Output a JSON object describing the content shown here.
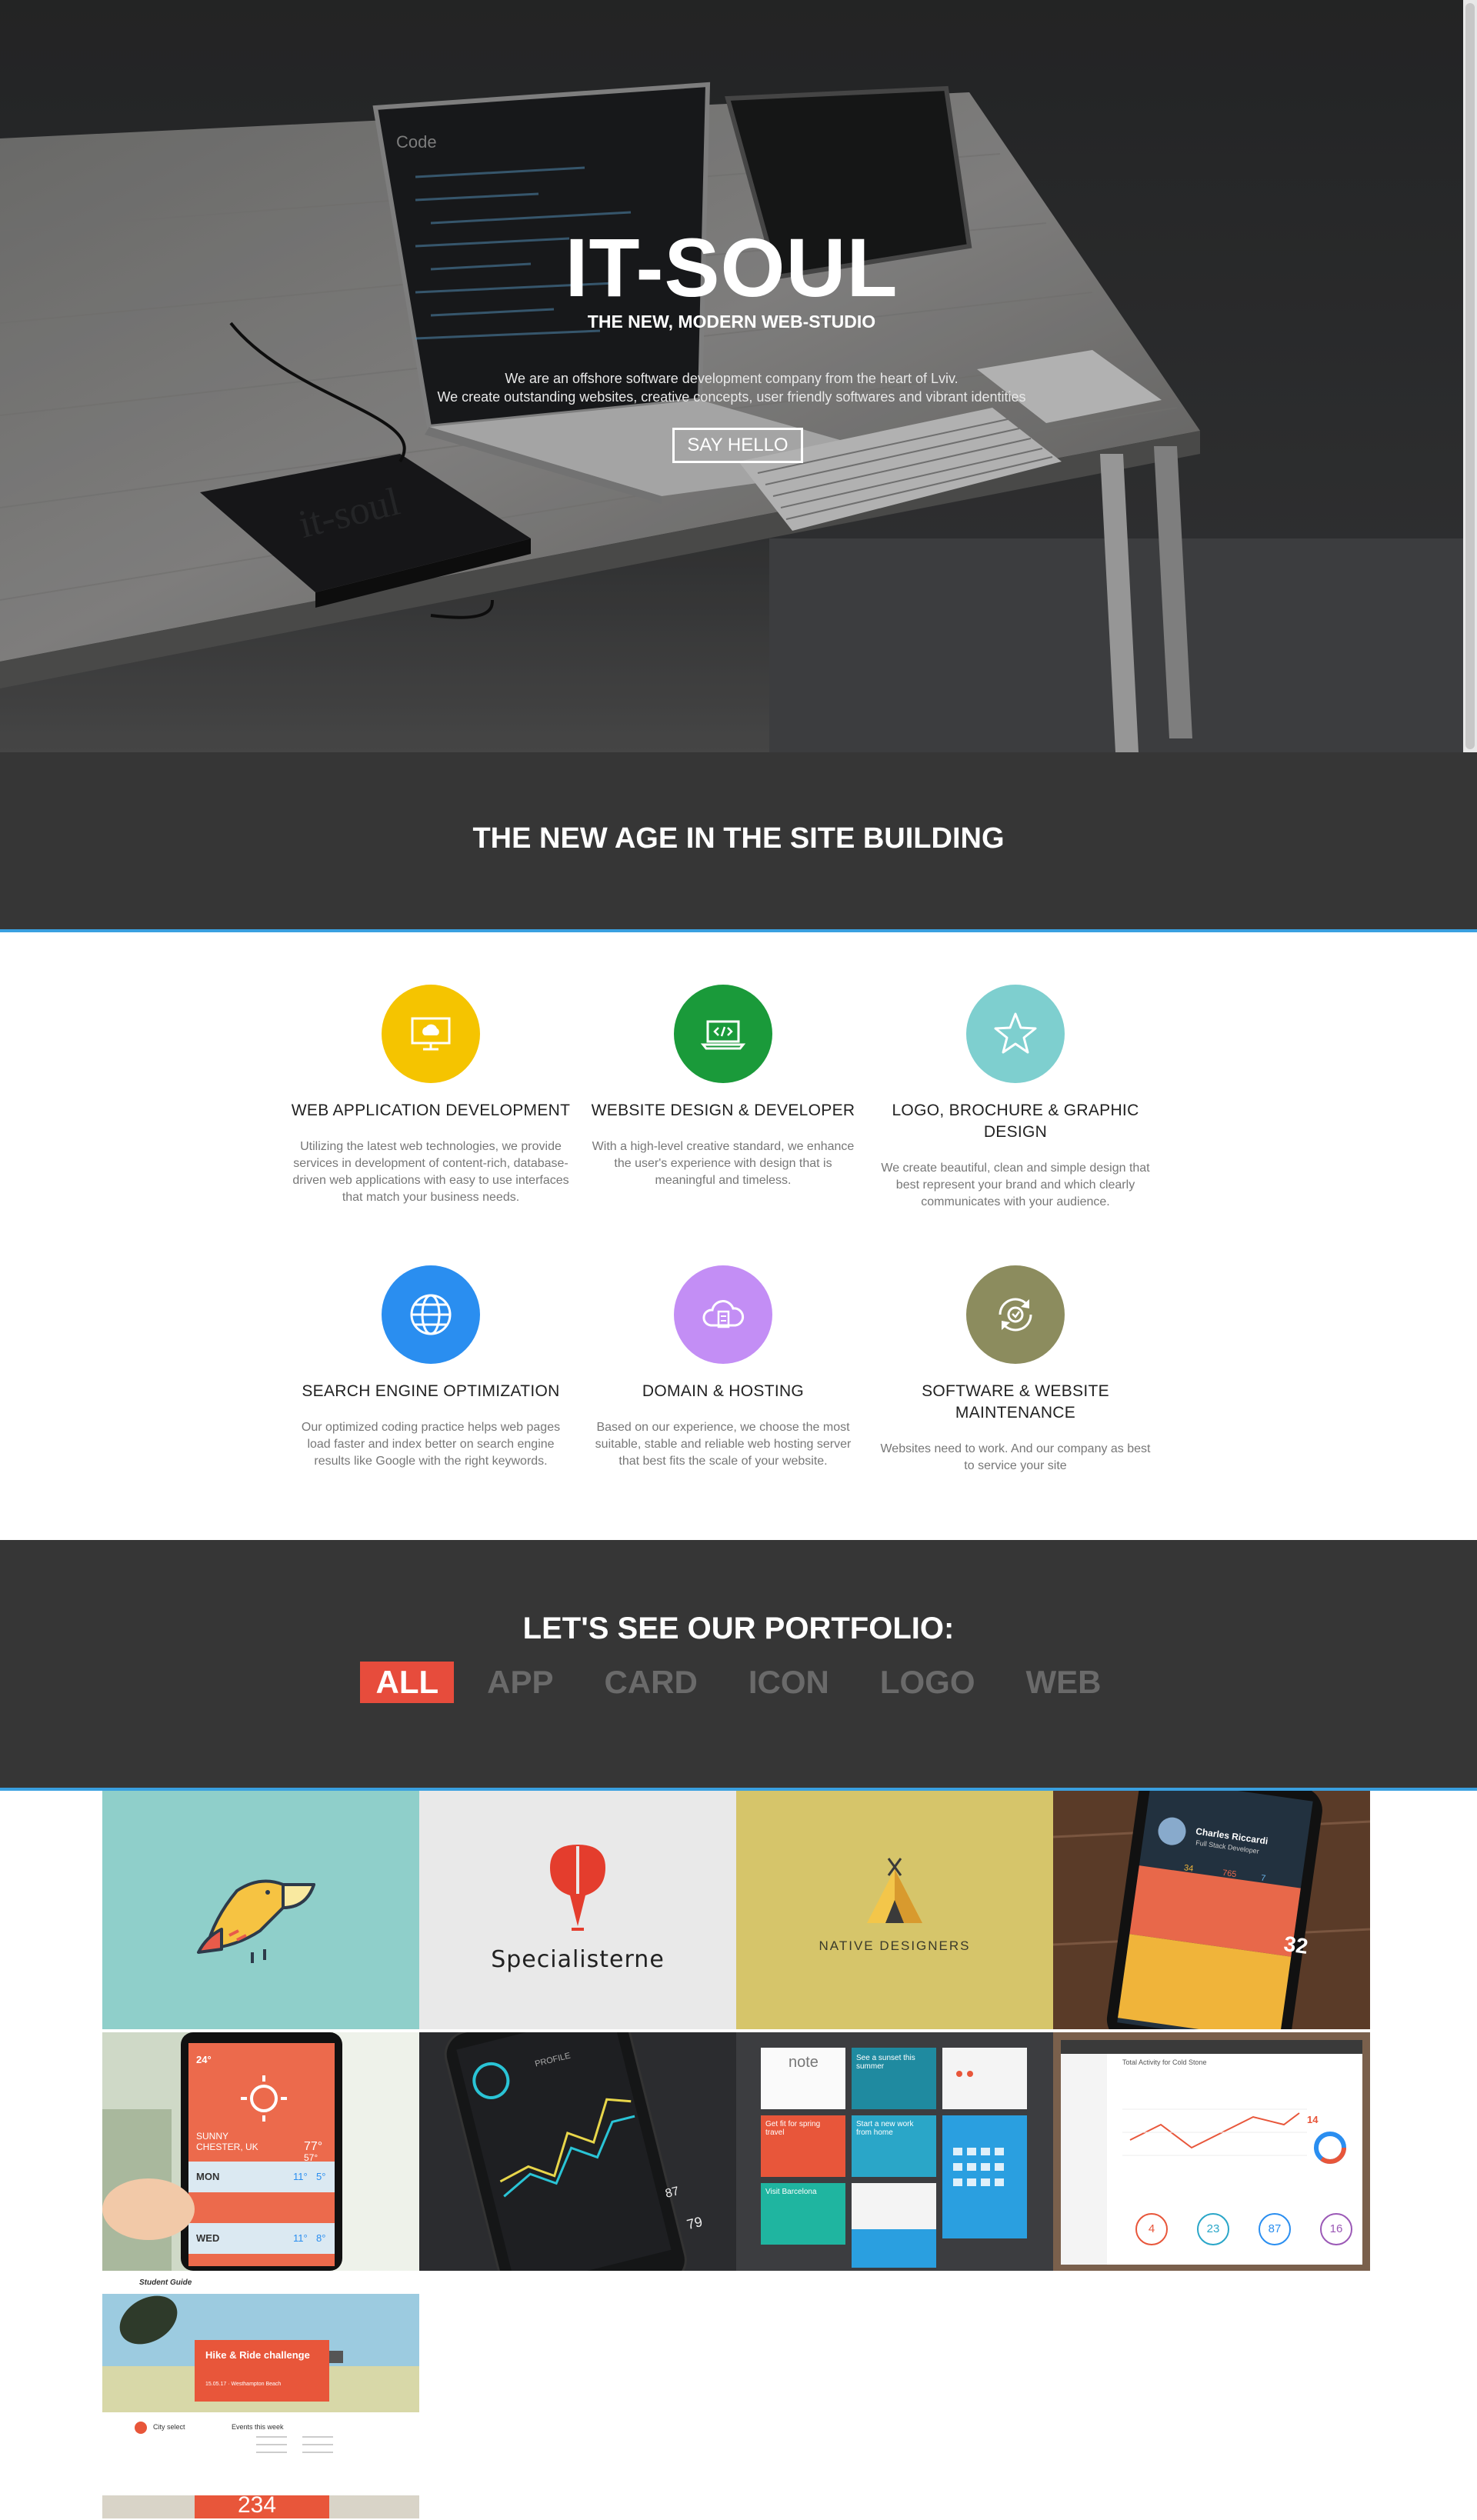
{
  "hero": {
    "title": "IT-SOUL",
    "subtitle": "THE NEW, MODERN WEB-STUDIO",
    "desc_line1": "We are an offshore software development company from the heart of Lviv.",
    "desc_line2": "We create outstanding websites, creative concepts, user friendly softwares and vibrant identities",
    "button": "SAY HELLO",
    "notebook_text": "it-soul",
    "screen_text": "Code"
  },
  "intro": {
    "title": "THE NEW AGE IN THE SITE BUILDING"
  },
  "services": [
    {
      "title": "WEB APPLICATION DEVELOPMENT",
      "text": "Utilizing the latest web technologies, we provide services in development of content-rich, database-driven web applications with easy to use interfaces that match your business needs.",
      "color": "#f5c400",
      "icon": "monitor-cloud-icon"
    },
    {
      "title": "WEBSITE DESIGN & DEVELOPER",
      "text": "With a high-level creative standard, we enhance the user's experience with design that is meaningful and timeless.",
      "color": "#1a9a3a",
      "icon": "laptop-code-icon"
    },
    {
      "title": "LOGO, BROCHURE & GRAPHIC DESIGN",
      "text": "We create beautiful, clean and simple design that best represent your brand and which clearly communicates with your audience.",
      "color": "#7ecfcf",
      "icon": "star-icon"
    },
    {
      "title": "SEARCH ENGINE OPTIMIZATION",
      "text": "Our optimized coding practice helps web pages load faster and index better on search engine results like Google with the right keywords.",
      "color": "#2a8ef0",
      "icon": "globe-icon"
    },
    {
      "title": "DOMAIN & HOSTING",
      "text": "Based on our experience, we choose the most suitable, stable and reliable web hosting server that best fits the scale of your website.",
      "color": "#c38ef5",
      "icon": "cloud-server-icon"
    },
    {
      "title": "SOFTWARE & WEBSITE MAINTENANCE",
      "text": "Websites need to work. And our company as best to service your site",
      "color": "#8c8c5e",
      "icon": "wrench-cycle-icon"
    }
  ],
  "portfolio": {
    "title": "LET'S SEE OUR PORTFOLIO:",
    "filters": [
      "ALL",
      "APP",
      "CARD",
      "ICON",
      "LOGO",
      "WEB"
    ],
    "active": "ALL",
    "items": {
      "specialisterne": "Specialisterne",
      "native": "NATIVE DESIGNERS",
      "profile_name": "Charles Riccardi",
      "profile_sub": "Full Stack Developer",
      "profile_count1": "34",
      "profile_count2": "765",
      "profile_count3": "7",
      "profile_big": "32",
      "weather_temp": "24°",
      "weather_loc": "SUNNY",
      "weather_city": "CHESTER, UK",
      "weather_hi": "77°",
      "weather_lo": "57°",
      "weather_day1": "MON",
      "weather_day1_hi": "11°",
      "weather_day1_lo": "5°",
      "weather_day2": "WED",
      "weather_day2_hi": "11°",
      "weather_day2_lo": "8°",
      "fitness_top": "PROFILE",
      "fitness_num1": "87",
      "fitness_num2": "79",
      "dash_title": "Total Activity for Cold Stone",
      "dash_num": "14",
      "dash_c1": "4",
      "dash_c2": "23",
      "dash_c3": "87",
      "dash_c4": "16",
      "card_note": "note",
      "card_t1": "See a sunset this summer",
      "card_t2": "Get fit for spring travel",
      "card_t3": "Start a new work from home",
      "card_t4": "Visit Barcelona",
      "hike_title": "Hike & Ride challenge",
      "hike_sub": "15.05.17 · Westhampton Beach",
      "hike_num": "234",
      "hike_city": "City select",
      "hike_events": "Events this week",
      "hike_logo": "Student Guide"
    }
  }
}
